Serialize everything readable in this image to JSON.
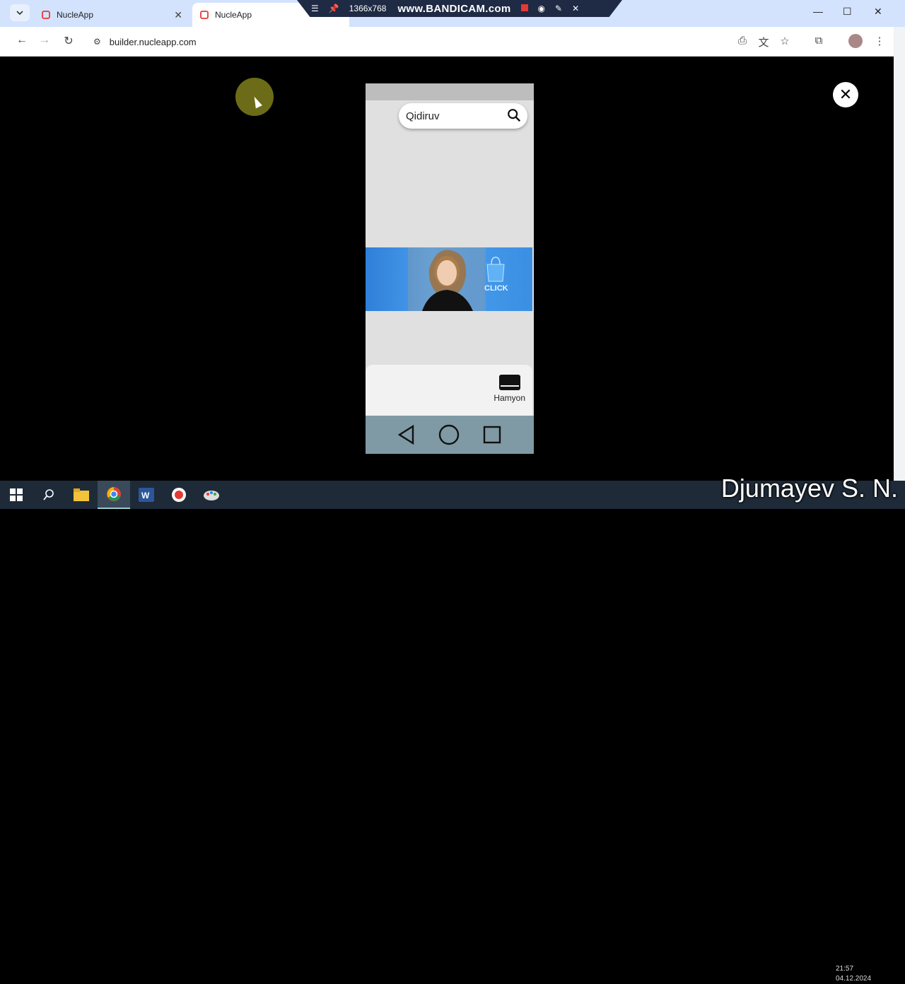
{
  "browser": {
    "tabs": [
      {
        "title": "NucleApp"
      },
      {
        "title": "NucleApp"
      }
    ],
    "url": "builder.nucleapp.com"
  },
  "recorder": {
    "resolution": "1366x768",
    "brand": "www.BANDICAM.com"
  },
  "app": {
    "search_placeholder": "Qidiruv",
    "bottom_nav_label": "Hamyon",
    "banner_badge": "CLICK"
  },
  "overlay": {
    "close_symbol": "✕"
  },
  "watermark": "Djumayev S. N.",
  "clock": {
    "time": "21:57",
    "date": "04.12.2024"
  },
  "colors": {
    "tabbar": "#d3e3fd",
    "taskbar": "#1e2a38",
    "phone_bg": "#e0e0e0",
    "sysnav": "#7f9aa5"
  }
}
